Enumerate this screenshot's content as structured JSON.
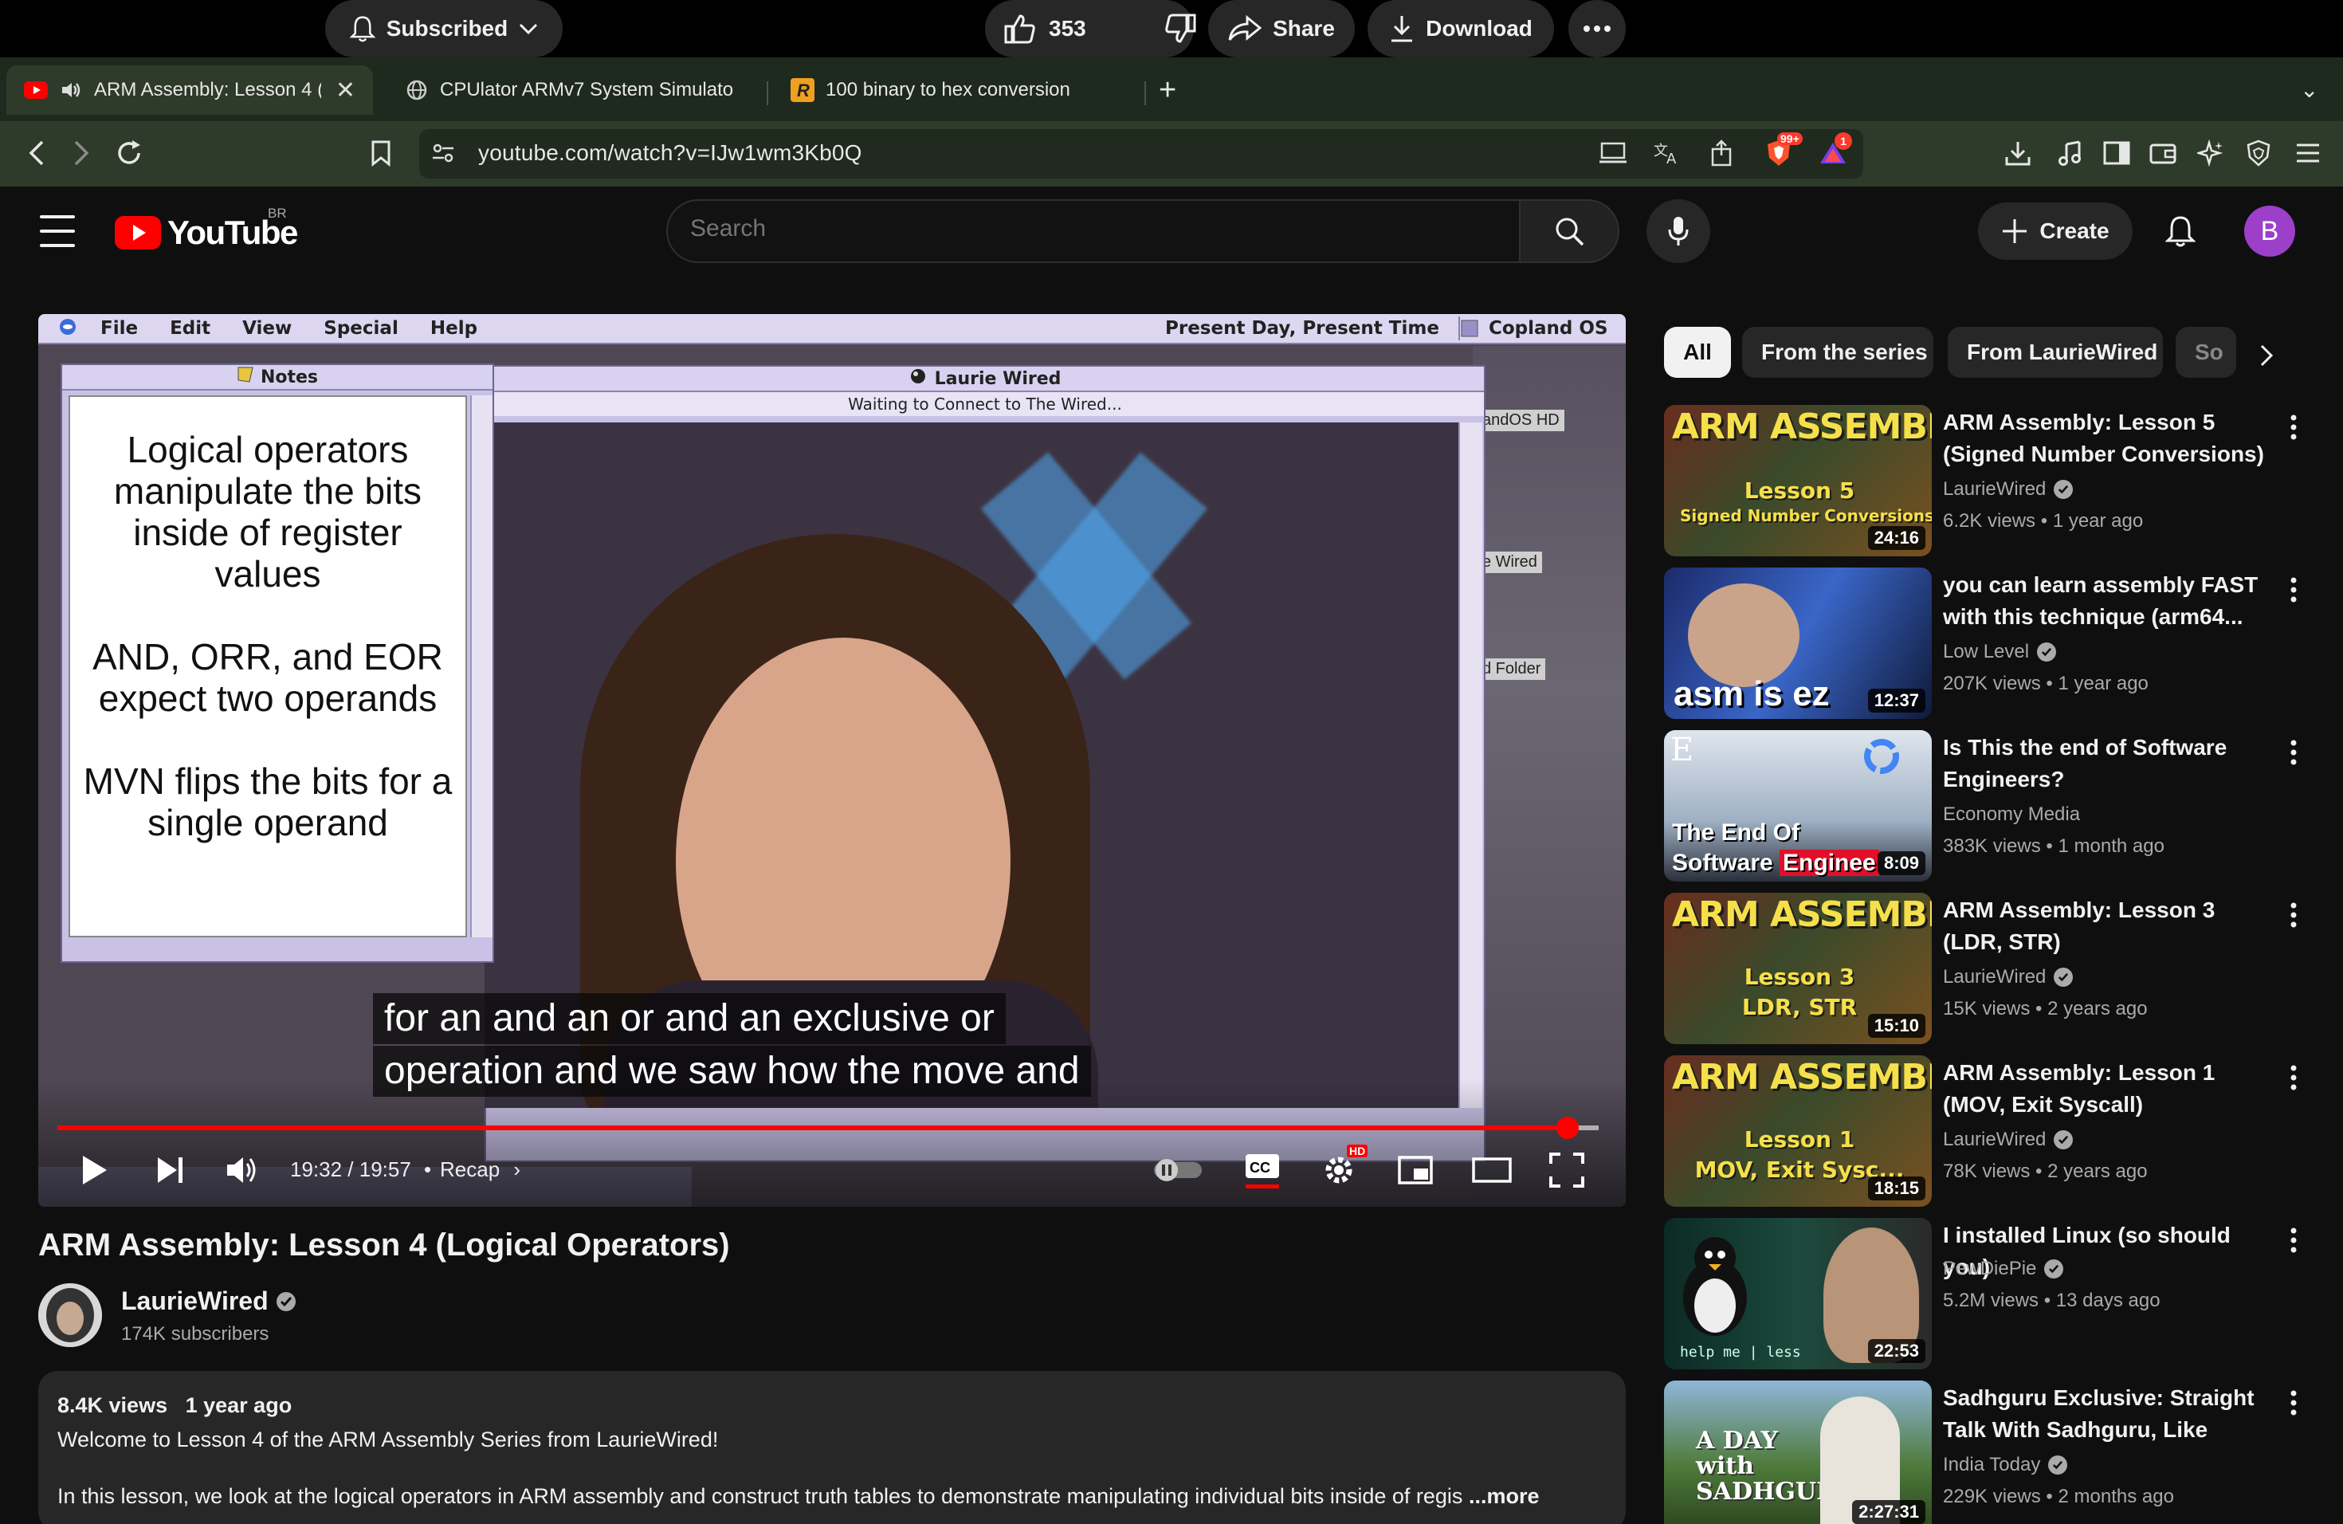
{
  "browser": {
    "tabs": [
      {
        "label": "ARM Assembly: Lesson 4 (",
        "active": true
      },
      {
        "label": "CPUlator ARMv7 System Simulato",
        "active": false
      },
      {
        "label": "100 binary to hex conversion",
        "active": false
      }
    ],
    "url": "youtube.com/watch?v=IJw1wm3Kb0Q",
    "brave_badge": "99+",
    "rewards_badge": "1"
  },
  "header": {
    "logo_text": "YouTube",
    "country_code": "BR",
    "search_placeholder": "Search",
    "create_label": "Create",
    "avatar_letter": "B"
  },
  "player": {
    "menubar": {
      "items": [
        "File",
        "Edit",
        "View",
        "Special",
        "Help"
      ],
      "clock": "Present Day, Present Time",
      "os_label": "Copland OS"
    },
    "notes_window": {
      "title": "Notes",
      "paragraphs": [
        "Logical operators manipulate the bits inside of register values",
        "AND, ORR, and EOR expect two operands",
        "MVN flips the bits for a single operand"
      ]
    },
    "video_window": {
      "title": "Laurie Wired",
      "status": "Waiting to Connect to The Wired..."
    },
    "desktop_labels": [
      "andOS HD",
      "e Wired",
      "d Folder"
    ],
    "captions": [
      "for an and an or and an exclusive or",
      "operation and we saw how the move and"
    ],
    "time": "19:32 / 19:57",
    "chapter": "Recap",
    "played_fraction": 0.98,
    "loaded_fraction": 1.0,
    "settings_badge": "HD"
  },
  "video": {
    "title": "ARM Assembly: Lesson 4 (Logical Operators)",
    "channel": "LaurieWired",
    "subscribers": "174K subscribers",
    "subscribed_label": "Subscribed",
    "likes": "353",
    "share_label": "Share",
    "download_label": "Download"
  },
  "description": {
    "views": "8.4K views",
    "age": "1 year ago",
    "line1": "Welcome to Lesson 4 of the ARM Assembly Series from LaurieWired!",
    "line2": "In this lesson, we look at the logical operators in ARM assembly and construct truth tables to demonstrate manipulating individual bits inside of regis",
    "more": "...more"
  },
  "sidebar": {
    "chips": [
      "All",
      "From the series",
      "From LaurieWired",
      "So"
    ],
    "recommendations": [
      {
        "title": "ARM Assembly: Lesson 5 (Signed Number Conversions)",
        "channel": "LaurieWired",
        "verified": true,
        "views": "6.2K views",
        "age": "1 year ago",
        "duration": "24:16",
        "thumb_title": "ARM ASSEMBLY",
        "thumb_sub": [
          "Lesson 5",
          "Signed Number Conversions"
        ]
      },
      {
        "title": "you can learn assembly FAST with this technique (arm64...",
        "channel": "Low Level",
        "verified": true,
        "views": "207K views",
        "age": "1 year ago",
        "duration": "12:37",
        "thumb_caption": "asm is ez"
      },
      {
        "title": "Is This the end of Software Engineers?",
        "channel": "Economy Media",
        "verified": false,
        "views": "383K views",
        "age": "1 month ago",
        "duration": "8:09",
        "thumb_caption": [
          "The End Of",
          "Software",
          "Enginee"
        ],
        "thumb_letter": "E"
      },
      {
        "title": "ARM Assembly: Lesson 3 (LDR, STR)",
        "channel": "LaurieWired",
        "verified": true,
        "views": "15K views",
        "age": "2 years ago",
        "duration": "15:10",
        "thumb_title": "ARM ASSEMBLY",
        "thumb_sub": [
          "Lesson 3",
          "LDR, STR"
        ]
      },
      {
        "title": "ARM Assembly: Lesson 1 (MOV, Exit Syscall)",
        "channel": "LaurieWired",
        "verified": true,
        "views": "78K views",
        "age": "2 years ago",
        "duration": "18:15",
        "thumb_title": "ARM ASSEMBLY",
        "thumb_sub": [
          "Lesson 1",
          "MOV, Exit Sysc..."
        ]
      },
      {
        "title": "I installed Linux (so should you)",
        "channel": "PewDiePie",
        "verified": true,
        "views": "5.2M views",
        "age": "13 days ago",
        "duration": "22:53",
        "thumb_caption": "help me | less"
      },
      {
        "title": "Sadhguru Exclusive: Straight Talk With Sadhguru, Like Neve...",
        "channel": "India Today",
        "verified": true,
        "views": "229K views",
        "age": "2 months ago",
        "duration": "2:27:31",
        "thumb_caption": "A DAY with SADHGURU"
      }
    ]
  }
}
